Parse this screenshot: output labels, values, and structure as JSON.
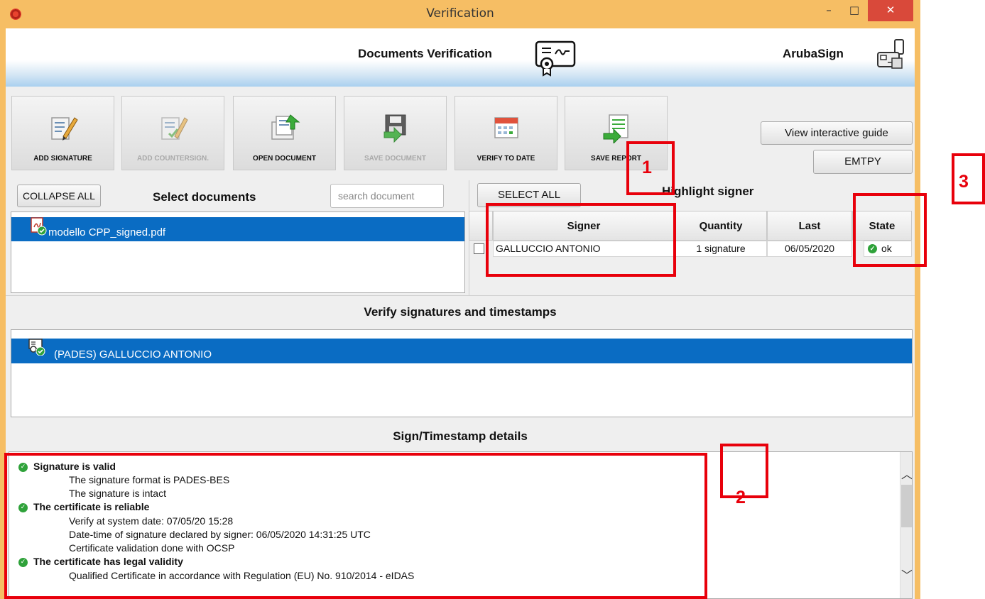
{
  "window": {
    "title": "Verification",
    "minimize": "–",
    "maximize": "□",
    "close": "✕"
  },
  "header": {
    "title": "Documents Verification",
    "brand": "ArubaSign"
  },
  "toolbar": [
    {
      "label": "ADD SIGNATURE",
      "enabled": true,
      "icon": "pen-document-icon"
    },
    {
      "label": "ADD COUNTERSIGN.",
      "enabled": false,
      "icon": "countersign-icon"
    },
    {
      "label": "OPEN DOCUMENT",
      "enabled": true,
      "icon": "open-document-icon"
    },
    {
      "label": "SAVE DOCUMENT",
      "enabled": false,
      "icon": "save-disk-icon"
    },
    {
      "label": "VERIFY TO DATE",
      "enabled": true,
      "icon": "calendar-icon"
    },
    {
      "label": "SAVE REPORT",
      "enabled": true,
      "icon": "report-icon"
    }
  ],
  "right_buttons": {
    "guide": "View interactive guide",
    "empty": "EMTPY"
  },
  "documents": {
    "collapse_label": "COLLAPSE ALL",
    "title": "Select documents",
    "search_placeholder": "search document",
    "items": [
      "modello CPP_signed.pdf"
    ]
  },
  "signers": {
    "select_all_label": "SELECT ALL",
    "title": "Highlight signer",
    "columns": [
      "Signer",
      "Quantity",
      "Last",
      "State"
    ],
    "rows": [
      {
        "signer": "GALLUCCIO ANTONIO",
        "quantity": "1 signature",
        "last": "06/05/2020",
        "state": "ok"
      }
    ]
  },
  "signatures": {
    "title": "Verify signatures and timestamps",
    "items": [
      "(PADES) GALLUCCIO ANTONIO"
    ]
  },
  "details": {
    "title": "Sign/Timestamp details",
    "lines": [
      {
        "kind": "head",
        "text": "Signature is valid"
      },
      {
        "kind": "sub",
        "text": "The signature format is PADES-BES"
      },
      {
        "kind": "sub",
        "text": "The signature is intact"
      },
      {
        "kind": "head",
        "text": "The certificate is reliable"
      },
      {
        "kind": "sub",
        "text": "Verify at system date: 07/05/20 15:28"
      },
      {
        "kind": "sub",
        "text": "Date-time of signature declared by signer: 06/05/2020 14:31:25 UTC"
      },
      {
        "kind": "sub",
        "text": "Certificate validation done with OCSP"
      },
      {
        "kind": "head",
        "text": "The certificate has legal validity"
      },
      {
        "kind": "sub",
        "text": "Qualified Certificate in accordance with Regulation (EU) No. 910/2014 - eIDAS"
      }
    ]
  },
  "annotations": [
    "1",
    "2",
    "3"
  ],
  "colors": {
    "selection": "#0a6cc3",
    "titlebar": "#f6be64",
    "annotation": "#e8000b",
    "ok": "#2fa23a"
  }
}
